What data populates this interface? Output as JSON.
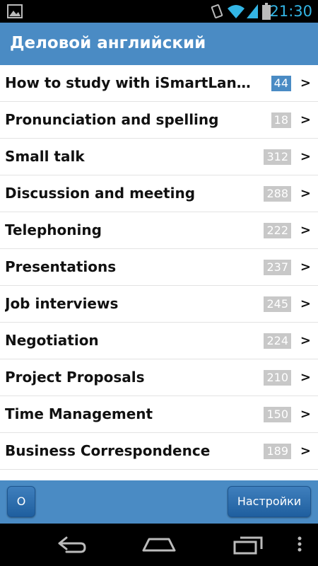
{
  "status_bar": {
    "time": "21:30",
    "icons": [
      "gallery-notification-icon",
      "vibrate-icon",
      "wifi-icon",
      "cell-signal-icon",
      "battery-icon"
    ]
  },
  "app_bar": {
    "title": "Деловой английский"
  },
  "topics": [
    {
      "label": "How to study with iSmartLanguage",
      "count": "44",
      "accent": true
    },
    {
      "label": "Pronunciation and spelling",
      "count": "18"
    },
    {
      "label": "Small talk",
      "count": "312"
    },
    {
      "label": "Discussion and meeting",
      "count": "288"
    },
    {
      "label": "Telephoning",
      "count": "222"
    },
    {
      "label": "Presentations",
      "count": "237"
    },
    {
      "label": "Job interviews",
      "count": "245"
    },
    {
      "label": "Negotiation",
      "count": "224"
    },
    {
      "label": "Project Proposals",
      "count": "210"
    },
    {
      "label": "Time Management",
      "count": "150"
    },
    {
      "label": "Business Correspondence",
      "count": "189"
    }
  ],
  "row_arrow": ">",
  "bottom_bar": {
    "about_label": "О",
    "settings_label": "Настройки"
  },
  "nav_bar": {
    "icons": [
      "back-icon",
      "home-icon",
      "recent-apps-icon",
      "menu-overflow-icon"
    ]
  },
  "colors": {
    "accent": "#4a8bc4",
    "count_badge": "#c8c8c8",
    "clock": "#33b5e5"
  }
}
